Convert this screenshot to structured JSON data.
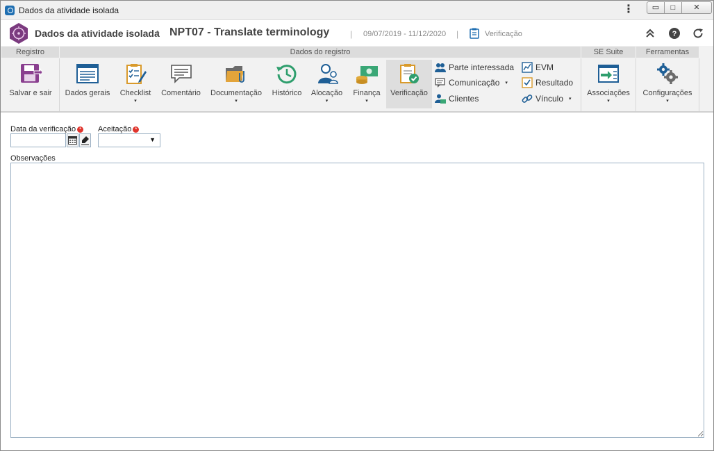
{
  "window": {
    "title": "Dados da atividade isolada"
  },
  "header": {
    "module": "Dados da atividade isolada",
    "separator": "›",
    "record": "NPT07 - Translate terminology",
    "dates": "09/07/2019 - 11/12/2020",
    "page": "Verificação"
  },
  "ribbon": {
    "groups": {
      "registro": "Registro",
      "dados": "Dados do registro",
      "suite": "SE Suite",
      "ferramentas": "Ferramentas"
    },
    "buttons": {
      "salvar": "Salvar e sair",
      "dados_gerais": "Dados gerais",
      "checklist": "Checklist",
      "comentario": "Comentário",
      "documentacao": "Documentação",
      "historico": "Histórico",
      "alocacao": "Alocação",
      "financa": "Finança",
      "verificacao": "Verificação",
      "associacoes": "Associações",
      "configuracoes": "Configurações"
    },
    "small": {
      "parte": "Parte interessada",
      "comunicacao": "Comunicação",
      "clientes": "Clientes",
      "evm": "EVM",
      "resultado": "Resultado",
      "vinculo": "Vínculo"
    },
    "caret": "▾"
  },
  "form": {
    "data_label": "Data da verificação",
    "data_value": "",
    "aceitacao_label": "Aceitação",
    "aceitacao_value": "",
    "observacoes_label": "Observações",
    "observacoes_value": ""
  },
  "colors": {
    "accent": "#1f6fb2",
    "logo": "#7b3a7f",
    "required": "#e0342c"
  }
}
